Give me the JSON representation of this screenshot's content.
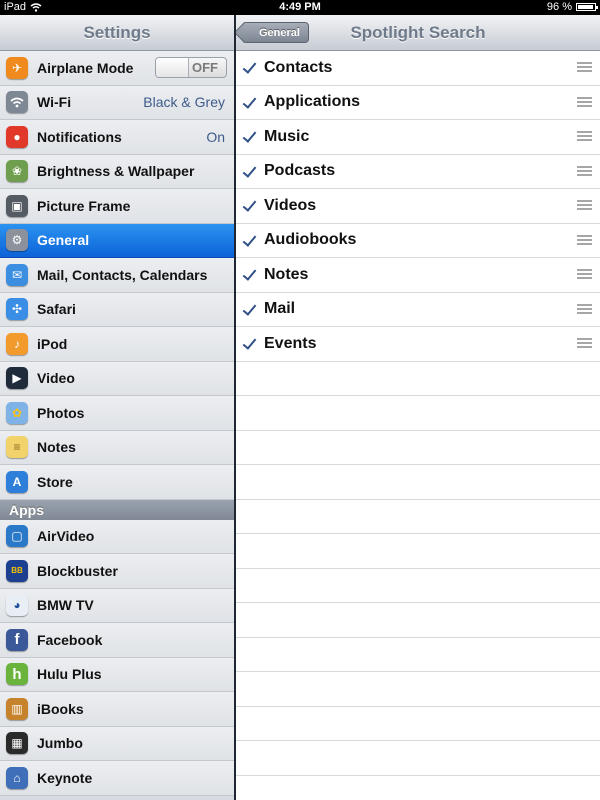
{
  "status_bar": {
    "device": "iPad",
    "time": "4:49 PM",
    "battery": "96 %",
    "battery_level": 0.96
  },
  "left_pane": {
    "title": "Settings",
    "items": [
      {
        "label": "Airplane Mode",
        "value": "OFF",
        "icon": "airplane-icon",
        "color": "#f08a1e"
      },
      {
        "label": "Wi-Fi",
        "value": "Black & Grey",
        "icon": "wifi-icon",
        "color": "#7e8794"
      },
      {
        "label": "Notifications",
        "value": "On",
        "icon": "notifications-icon",
        "color": "#e2382a"
      },
      {
        "label": "Brightness & Wallpaper",
        "value": "",
        "icon": "brightness-wallpaper-icon",
        "color": "#6f9f4e"
      },
      {
        "label": "Picture Frame",
        "value": "",
        "icon": "picture-frame-icon",
        "color": "#555b63"
      },
      {
        "label": "General",
        "value": "",
        "icon": "gear-icon",
        "color": "#8b929c"
      },
      {
        "label": "Mail, Contacts, Calendars",
        "value": "",
        "icon": "mail-icon",
        "color": "#3c8fe0"
      },
      {
        "label": "Safari",
        "value": "",
        "icon": "compass-icon",
        "color": "#3a8ee6"
      },
      {
        "label": "iPod",
        "value": "",
        "icon": "ipod-icon",
        "color": "#f29b2c"
      },
      {
        "label": "Video",
        "value": "",
        "icon": "video-icon",
        "color": "#1f2a3a"
      },
      {
        "label": "Photos",
        "value": "",
        "icon": "sunflower-icon",
        "color": "#7fb3e8"
      },
      {
        "label": "Notes",
        "value": "",
        "icon": "notes-icon",
        "color": "#f2d36b"
      },
      {
        "label": "Store",
        "value": "",
        "icon": "store-icon",
        "color": "#2e7fd9"
      }
    ],
    "apps_section": "Apps",
    "apps": [
      {
        "label": "AirVideo",
        "icon": "airvideo-icon",
        "color": "#2a79c9"
      },
      {
        "label": "Blockbuster",
        "icon": "blockbuster-icon",
        "color": "#1d3f8f"
      },
      {
        "label": "BMW TV",
        "icon": "bmw-icon",
        "color": "#e9eef4"
      },
      {
        "label": "Facebook",
        "icon": "facebook-icon",
        "color": "#3b5998"
      },
      {
        "label": "Hulu Plus",
        "icon": "hulu-icon",
        "color": "#6ab43e"
      },
      {
        "label": "iBooks",
        "icon": "ibooks-icon",
        "color": "#c7832b"
      },
      {
        "label": "Jumbo",
        "icon": "jumbo-icon",
        "color": "#2a2a2a"
      },
      {
        "label": "Keynote",
        "icon": "keynote-icon",
        "color": "#3f6fb8"
      }
    ]
  },
  "right_pane": {
    "title": "Spotlight Search",
    "back_label": "General",
    "items": [
      {
        "label": "Contacts"
      },
      {
        "label": "Applications"
      },
      {
        "label": "Music"
      },
      {
        "label": "Podcasts"
      },
      {
        "label": "Videos"
      },
      {
        "label": "Audiobooks"
      },
      {
        "label": "Notes"
      },
      {
        "label": "Mail"
      },
      {
        "label": "Events"
      }
    ]
  }
}
